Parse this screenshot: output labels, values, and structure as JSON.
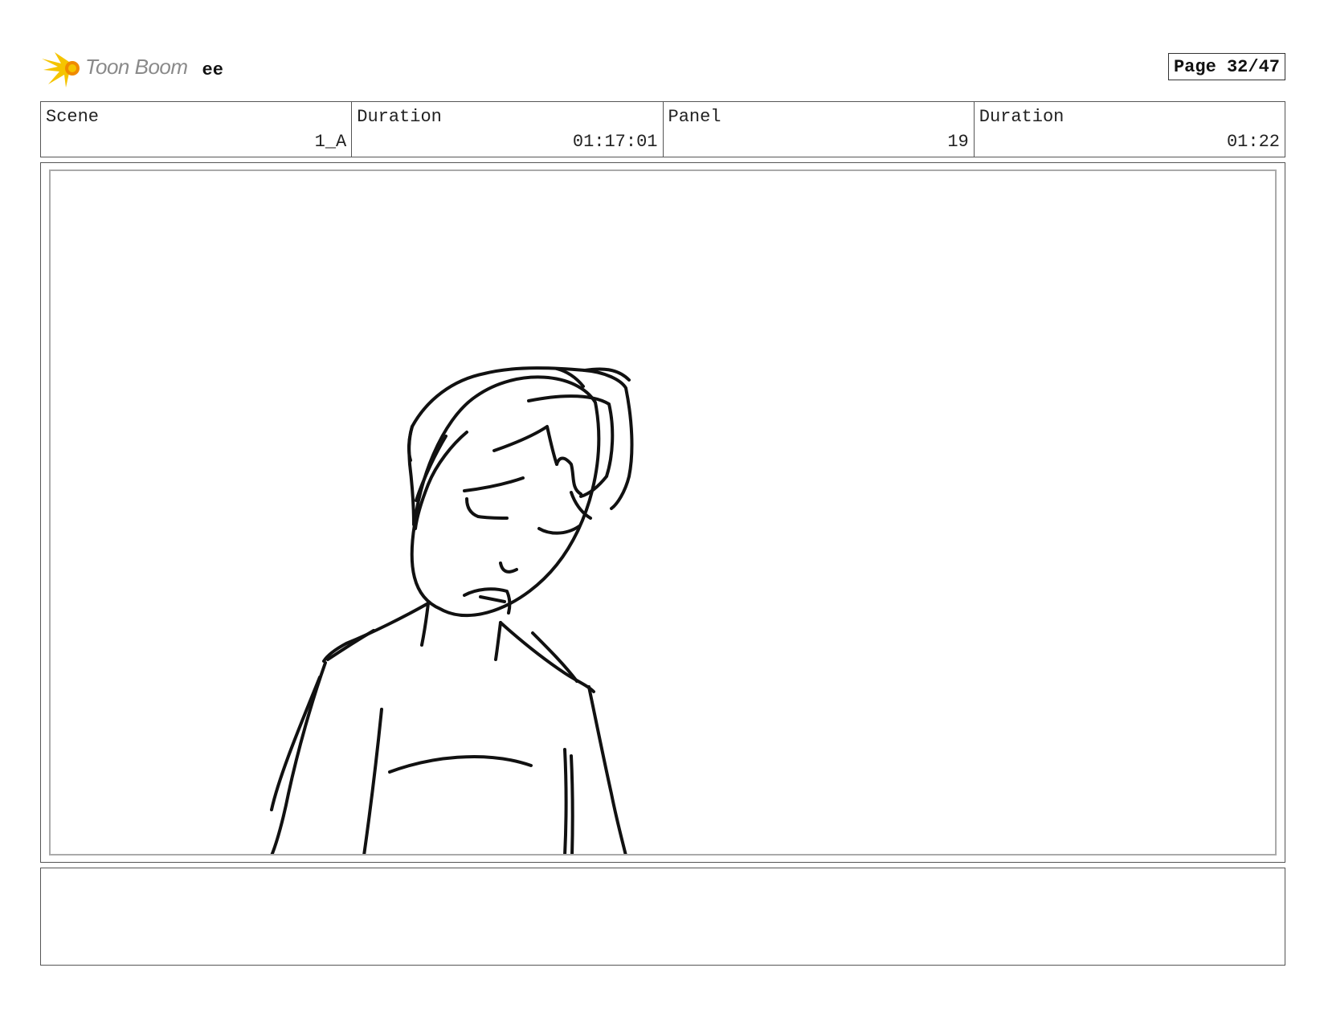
{
  "header": {
    "logo_text": "Toon Boom",
    "project_name": "ee",
    "page_label": "Page 32/47"
  },
  "info": [
    {
      "label": "Scene",
      "value": "1_A"
    },
    {
      "label": "Duration",
      "value": "01:17:01"
    },
    {
      "label": "Panel",
      "value": "19"
    },
    {
      "label": "Duration",
      "value": "01:22"
    }
  ],
  "panel": {
    "image": "sketch-of-character-head-tilted-eyes-closed"
  },
  "notes": {
    "text": ""
  },
  "colors": {
    "logo_yellow": "#f5c400",
    "logo_orange": "#f08a00",
    "logo_gray": "#8a8a8a"
  }
}
